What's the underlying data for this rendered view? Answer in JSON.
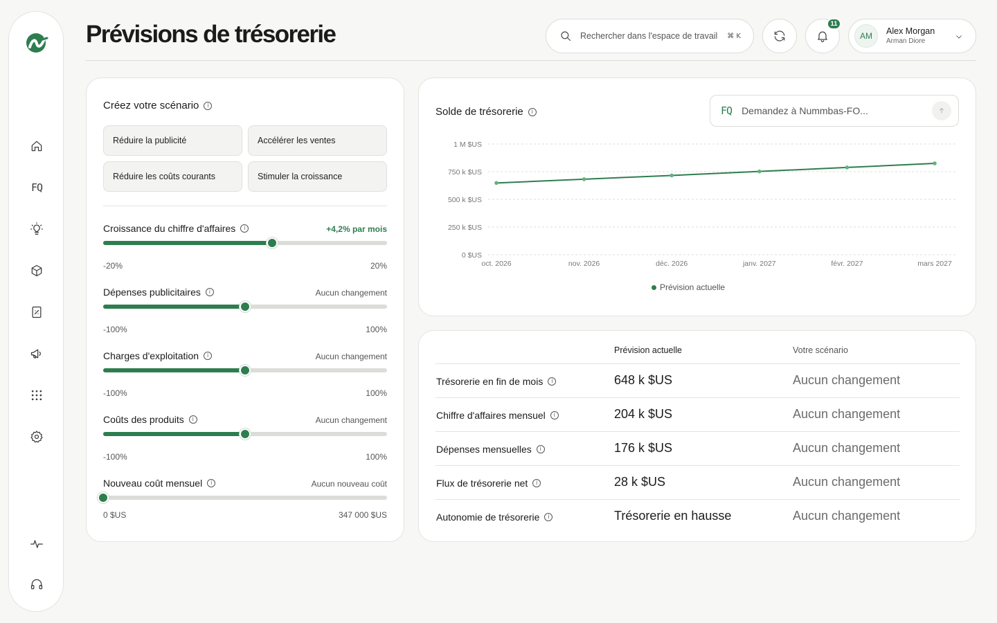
{
  "page": {
    "title": "Prévisions de trésorerie"
  },
  "colors": {
    "accent": "#2e7d4f",
    "background": "#f7f7f6",
    "card": "#ffffff"
  },
  "sidebar": {
    "items": [
      {
        "name": "home",
        "icon": "home-icon"
      },
      {
        "name": "fq",
        "icon": "fq-icon",
        "glyph": "FQ"
      },
      {
        "name": "insights",
        "icon": "lightbulb-icon"
      },
      {
        "name": "products",
        "icon": "box-icon"
      },
      {
        "name": "reports",
        "icon": "report-icon"
      },
      {
        "name": "marketing",
        "icon": "megaphone-icon"
      },
      {
        "name": "apps",
        "icon": "grid-icon"
      },
      {
        "name": "settings",
        "icon": "gear-icon"
      },
      {
        "name": "activity",
        "icon": "pulse-icon"
      },
      {
        "name": "support",
        "icon": "headset-icon"
      }
    ]
  },
  "header": {
    "search": {
      "placeholder": "Rechercher dans l'espace de travail",
      "shortcut": "⌘ K"
    },
    "notifications": {
      "count": "11"
    },
    "user": {
      "initials": "AM",
      "name": "Alex Morgan",
      "subtitle": "Arman Diore"
    }
  },
  "scenario": {
    "title": "Créez votre scénario",
    "presets": [
      "Réduire la publicité",
      "Accélérer les ventes",
      "Réduire les coûts courants",
      "Stimuler la croissance"
    ],
    "sliders": [
      {
        "label": "Croissance du chiffre d'affaires",
        "value_text": "+4,2% par mois",
        "min": "-20%",
        "max": "20%",
        "fraction": 0.595
      },
      {
        "label": "Dépenses publicitaires",
        "value_text": "Aucun changement",
        "min": "-100%",
        "max": "100%",
        "fraction": 0.5
      },
      {
        "label": "Charges d'exploitation",
        "value_text": "Aucun changement",
        "min": "-100%",
        "max": "100%",
        "fraction": 0.5
      },
      {
        "label": "Coûts des produits",
        "value_text": "Aucun changement",
        "min": "-100%",
        "max": "100%",
        "fraction": 0.5
      },
      {
        "label": "Nouveau coût mensuel",
        "value_text": "Aucun nouveau coût",
        "min": "0 $US",
        "max": "347 000 $US",
        "fraction": 0.0
      }
    ]
  },
  "cash_chart": {
    "title": "Solde de trésorerie",
    "ask_placeholder": "Demandez à Nummbas-FO...",
    "ask_glyph": "FQ"
  },
  "chart_data": {
    "type": "line",
    "x": [
      "oct. 2026",
      "nov. 2026",
      "déc. 2026",
      "janv. 2027",
      "févr. 2027",
      "mars 2027"
    ],
    "y_ticks": [
      0,
      250000,
      500000,
      750000,
      1000000
    ],
    "y_tick_labels": [
      "0 $US",
      "250 k $US",
      "500 k $US",
      "750 k $US",
      "1 M $US"
    ],
    "ylim": [
      0,
      1000000
    ],
    "grid": true,
    "legend": "bottom-center",
    "series": [
      {
        "name": "Prévision actuelle",
        "color": "#2e7d4f",
        "values": [
          648000,
          682000,
          716000,
          752000,
          788000,
          825000
        ]
      }
    ]
  },
  "summary": {
    "col_current": "Prévision actuelle",
    "col_scenario": "Votre scénario",
    "rows": [
      {
        "label": "Trésorerie en fin de mois",
        "current": "648 k $US",
        "scenario": "Aucun changement"
      },
      {
        "label": "Chiffre d'affaires mensuel",
        "current": "204 k $US",
        "scenario": "Aucun changement"
      },
      {
        "label": "Dépenses mensuelles",
        "current": "176 k $US",
        "scenario": "Aucun changement"
      },
      {
        "label": "Flux de trésorerie net",
        "current": "28 k $US",
        "scenario": "Aucun changement"
      },
      {
        "label": "Autonomie de trésorerie",
        "current": "Trésorerie en hausse",
        "scenario": "Aucun changement"
      }
    ]
  }
}
